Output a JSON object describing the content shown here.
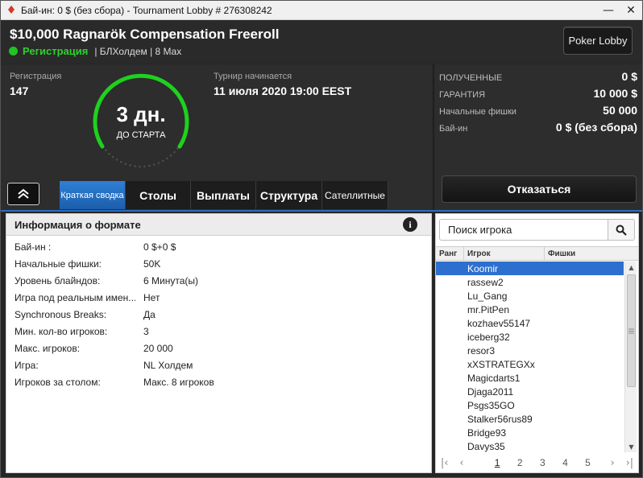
{
  "window": {
    "title": "Бай-ин: 0 $ (без сбора) - Tournament Lobby # 276308242",
    "minimize": "—",
    "close": "✕"
  },
  "header": {
    "tournament_name": "$10,000 Ragnarök Compensation Freeroll",
    "status": "Регистрация",
    "game_info": "| БЛХолдем | 8 Max",
    "poker_lobby_button": "Poker Lobby"
  },
  "summary": {
    "registration_label": "Регистрация",
    "registration_count": "147",
    "countdown_value": "3 дн.",
    "countdown_caption": "ДО СТАРТА",
    "start_label": "Турнир начинается",
    "start_value": "11 июля 2020  19:00 EEST"
  },
  "prize_info": {
    "rows": [
      {
        "label": "ПОЛУЧЕННЫЕ",
        "value": "0 $"
      },
      {
        "label": "ГАРАНТИЯ",
        "value": "10 000 $"
      },
      {
        "label": "Начальные фишки",
        "value": "50 000"
      },
      {
        "label": "Бай-ин",
        "value": "0 $ (без сбора)"
      }
    ],
    "decline_button": "Отказаться"
  },
  "tabs": [
    {
      "label": "Краткая сводка",
      "active": true
    },
    {
      "label": "Столы",
      "active": false
    },
    {
      "label": "Выплаты",
      "active": false
    },
    {
      "label": "Структура",
      "active": false
    },
    {
      "label": "Сателлитные",
      "active": false
    }
  ],
  "format_info": {
    "title": "Информация о формате",
    "info_icon_glyph": "i",
    "rows": [
      {
        "key": "Бай-ин :",
        "value": "0 $+0 $"
      },
      {
        "key": "Начальные фишки:",
        "value": "50K"
      },
      {
        "key": "Уровень блайндов:",
        "value": "6 Минута(ы)"
      },
      {
        "key": "Игра под реальным имен...",
        "value": "Нет"
      },
      {
        "key": "Synchronous Breaks:",
        "value": "Да"
      },
      {
        "key": "Мин. кол-во игроков:",
        "value": "3"
      },
      {
        "key": "Макс. игроков:",
        "value": "20 000"
      },
      {
        "key": "Игра:",
        "value": "NL Холдем"
      },
      {
        "key": "Игроков за столом:",
        "value": "Макс. 8 игроков"
      }
    ]
  },
  "players": {
    "search_placeholder": "Поиск игрока",
    "columns": [
      "Ранг",
      "Игрок",
      "Фишки"
    ],
    "list": [
      "Koomir",
      "rassew2",
      "Lu_Gang",
      "mr.PitPen",
      "kozhaev55147",
      "iceberg32",
      "resor3",
      "xXSTRATEGXx",
      "Magicdarts1",
      "Djaga2011",
      "Psgs35GO",
      "Stalker56rus89",
      "Bridge93",
      "Davys35"
    ],
    "selected_index": 0,
    "pages": [
      "1",
      "2",
      "3",
      "4",
      "5"
    ],
    "current_page": "1"
  },
  "colors": {
    "accent_blue": "#2d6fcf",
    "status_green": "#22c322"
  }
}
